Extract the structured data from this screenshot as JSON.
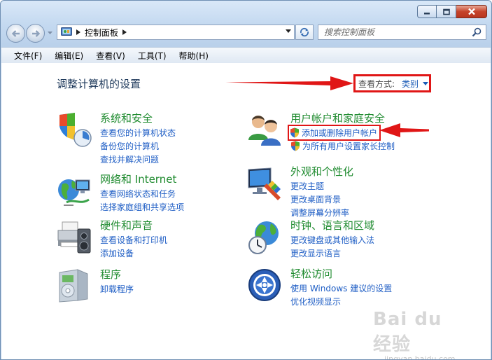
{
  "window": {
    "address_segment": "控制面板",
    "search_placeholder": "搜索控制面板"
  },
  "menu": [
    "文件(F)",
    "编辑(E)",
    "查看(V)",
    "工具(T)",
    "帮助(H)"
  ],
  "content": {
    "title": "调整计算机的设置",
    "view_by_label": "查看方式:",
    "view_by_value": "类别"
  },
  "categories": [
    {
      "title": "系统和安全",
      "links": [
        "查看您的计算机状态",
        "备份您的计算机",
        "查找并解决问题"
      ]
    },
    {
      "title": "网络和 Internet",
      "links": [
        "查看网络状态和任务",
        "选择家庭组和共享选项"
      ]
    },
    {
      "title": "硬件和声音",
      "links": [
        "查看设备和打印机",
        "添加设备"
      ]
    },
    {
      "title": "程序",
      "links": [
        "卸载程序"
      ]
    },
    {
      "title": "用户帐户和家庭安全",
      "links": [
        "添加或删除用户帐户",
        "为所有用户设置家长控制"
      ]
    },
    {
      "title": "外观和个性化",
      "links": [
        "更改主题",
        "更改桌面背景",
        "调整屏幕分辨率"
      ]
    },
    {
      "title": "时钟、语言和区域",
      "links": [
        "更改键盘或其他输入法",
        "更改显示语言"
      ]
    },
    {
      "title": "轻松访问",
      "links": [
        "使用 Windows 建议的设置",
        "优化视频显示"
      ]
    }
  ],
  "watermark": {
    "top": "Bai du 经验",
    "bottom": "jingyan.baidu.com"
  },
  "colors": {
    "highlight_red": "#e01616",
    "link_blue": "#1f5ec5",
    "category_green": "#1f8b2f",
    "title_navy": "#1e395b"
  }
}
